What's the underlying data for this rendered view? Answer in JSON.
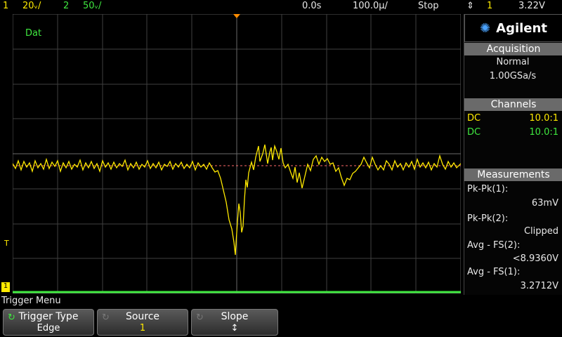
{
  "colors": {
    "ch1": "#ffea00",
    "ch2": "#3fe83f",
    "grid": "#4a4a4a",
    "accent": "#ff8c00"
  },
  "top_bar": {
    "ch1_num": "1",
    "ch1_scale": "20ᵥ/",
    "ch2_num": "2",
    "ch2_scale": "50ᵥ/",
    "time_pos": "0.0s",
    "time_scale": "100.0µ/",
    "run_state": "Stop",
    "trig_icon": "trigger-edge-icon",
    "trig_src": "1",
    "trig_level": "3.22V"
  },
  "screen": {
    "label": "Dat"
  },
  "panel": {
    "brand": "Agilent",
    "acquisition": {
      "header": "Acquisition",
      "mode": "Normal",
      "rate": "1.00GSa/s"
    },
    "channels": {
      "header": "Channels",
      "rows": [
        {
          "coupling": "DC",
          "probe": "10.0:1"
        },
        {
          "coupling": "DC",
          "probe": "10.0:1"
        }
      ]
    },
    "measurements": {
      "header": "Measurements",
      "items": [
        {
          "label": "Pk-Pk(1):",
          "value": "63mV"
        },
        {
          "label": "Pk-Pk(2):",
          "value": "Clipped"
        },
        {
          "label": "Avg - FS(2):",
          "value": "<8.9360V"
        },
        {
          "label": "Avg - FS(1):",
          "value": "3.2712V"
        }
      ]
    }
  },
  "menu": {
    "title": "Trigger Menu",
    "keys": [
      {
        "label": "Trigger Type",
        "value": "Edge"
      },
      {
        "label": "Source",
        "value": "1"
      },
      {
        "label": "Slope",
        "value": "↕"
      }
    ]
  }
}
